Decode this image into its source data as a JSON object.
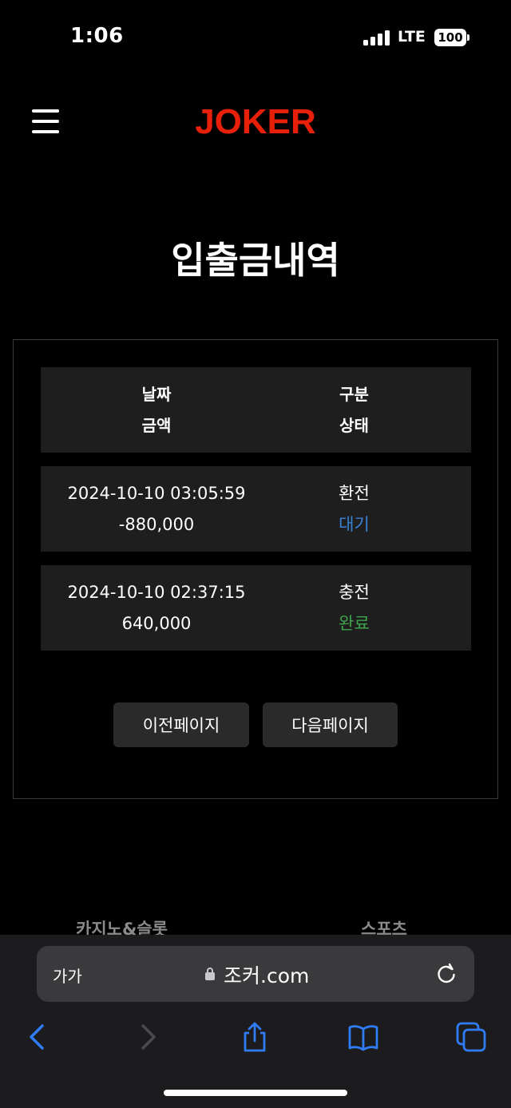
{
  "status_bar": {
    "time": "1:06",
    "network": "LTE",
    "battery": "100"
  },
  "header": {
    "logo": "JOKER"
  },
  "page": {
    "title": "입출금내역"
  },
  "table": {
    "header": {
      "date": "날짜",
      "amount": "금액",
      "type": "구분",
      "status": "상태"
    },
    "rows": [
      {
        "date": "2024-10-10 03:05:59",
        "amount": "-880,000",
        "type": "환전",
        "status": "대기",
        "status_color": "#3b82d6"
      },
      {
        "date": "2024-10-10 02:37:15",
        "amount": "640,000",
        "type": "충전",
        "status": "완료",
        "status_color": "#3fa34d"
      }
    ]
  },
  "pagination": {
    "prev": "이전페이지",
    "next": "다음페이지"
  },
  "footer_menu": {
    "casino": "카지노&슬롯",
    "sports": "스포츠"
  },
  "browser": {
    "text_size": "가가",
    "url": "조커.com"
  },
  "icons": [
    "menu-icon",
    "lock-icon",
    "reload-icon",
    "back-icon",
    "forward-icon",
    "share-icon",
    "bookmarks-icon",
    "tabs-icon"
  ],
  "colors": {
    "logo": "#e8200a",
    "pending": "#3b82d6",
    "complete": "#3fa34d",
    "accent_blue": "#2f7cf6"
  }
}
